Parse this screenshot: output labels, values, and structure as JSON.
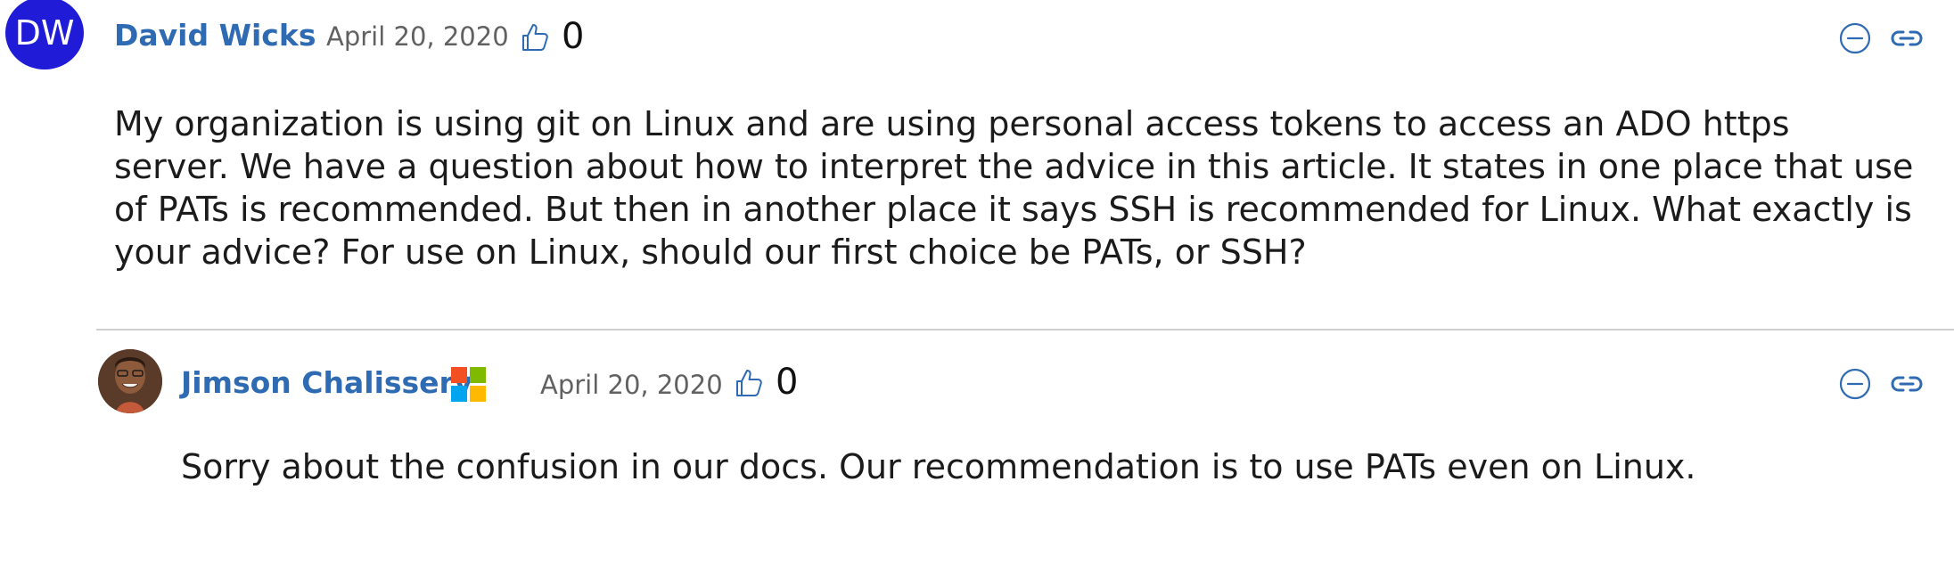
{
  "comments": [
    {
      "avatar_initials": "DW",
      "author": "David Wicks",
      "date": "April 20, 2020",
      "likes": "0",
      "body": "My organization is using git on Linux and are using personal access tokens to access an ADO https\nserver. We have a question about how to interpret the advice in this article. It states in one place that use\nof PATs is recommended. But then in another place it says SSH is recommended for Linux. What exactly is\nyour advice? For use on Linux, should our first choice be PATs, or SSH?"
    },
    {
      "author": "Jimson Chalissery",
      "date": "April 20, 2020",
      "likes": "0",
      "body": "Sorry about the confusion in our docs. Our recommendation is to use PATs even on Linux."
    }
  ],
  "colors": {
    "author_link": "#2f6bb3",
    "avatar_bg": "#1f1bd6",
    "icon_blue": "#2f6bb3",
    "date_gray": "#616161",
    "divider": "#d0d0d0"
  },
  "icons": {
    "like": "thumbs-up-icon",
    "collapse": "minus-circle-icon",
    "link": "link-icon",
    "badge": "microsoft-logo-icon"
  }
}
